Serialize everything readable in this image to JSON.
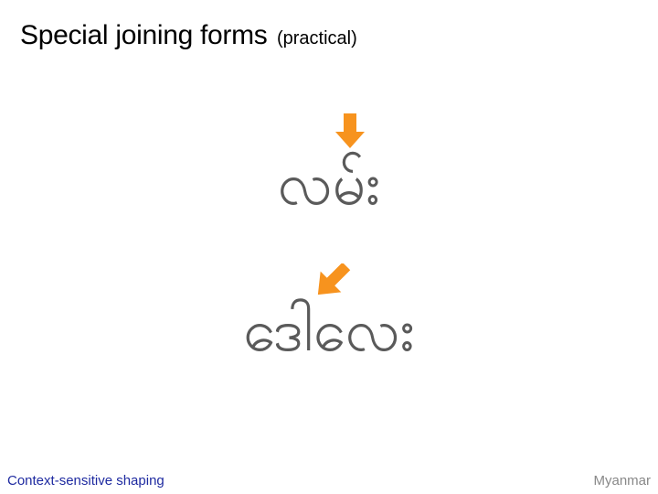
{
  "title": {
    "main": "Special joining forms",
    "sub": "(practical)"
  },
  "examples": [
    {
      "text": "လမ်း",
      "arrow_icon": "down-arrow-icon"
    },
    {
      "text": "ဒေါလေး",
      "arrow_icon": "diagonal-arrow-icon"
    }
  ],
  "footer": {
    "left": "Context-sensitive shaping",
    "right": "Myanmar"
  },
  "colors": {
    "arrow": "#f7931e",
    "glyph": "#5a5a5a",
    "footer_left": "#1e2aa0",
    "footer_right": "#888888"
  }
}
